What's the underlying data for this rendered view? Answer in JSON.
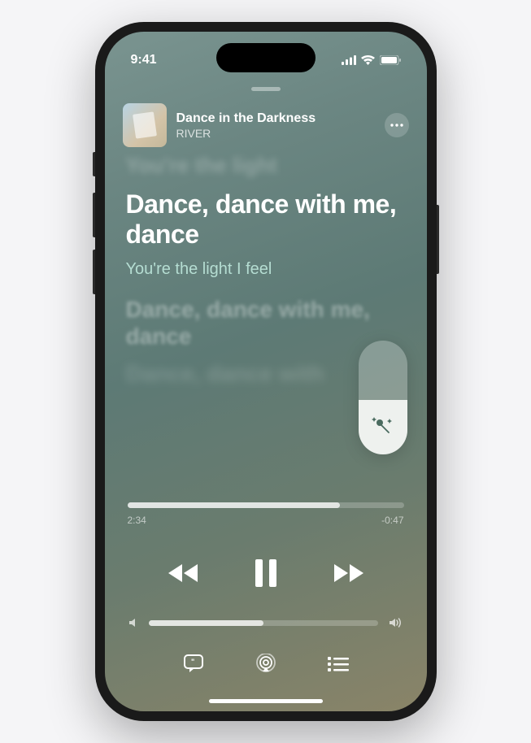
{
  "status": {
    "time": "9:41"
  },
  "track": {
    "title": "Dance in the Darkness",
    "artist": "RIVER"
  },
  "lyrics": {
    "prev_far": "You're the light",
    "current": "Dance, dance with me, dance",
    "next": "You're the light I feel",
    "future": "Dance, dance with me, dance",
    "future2": "Dance, dance with"
  },
  "playback": {
    "elapsed": "2:34",
    "remaining": "-0:47",
    "progress_pct": 77,
    "volume_pct": 50,
    "vocal_slider_pct": 48
  },
  "icons": {
    "more": "more-icon",
    "mic": "mic-sparkle-icon",
    "prev": "rewind-icon",
    "pause": "pause-icon",
    "next": "forward-icon",
    "vol_low": "volume-low-icon",
    "vol_high": "volume-high-icon",
    "lyrics_btn": "lyrics-icon",
    "airplay": "airplay-icon",
    "queue": "queue-icon"
  }
}
